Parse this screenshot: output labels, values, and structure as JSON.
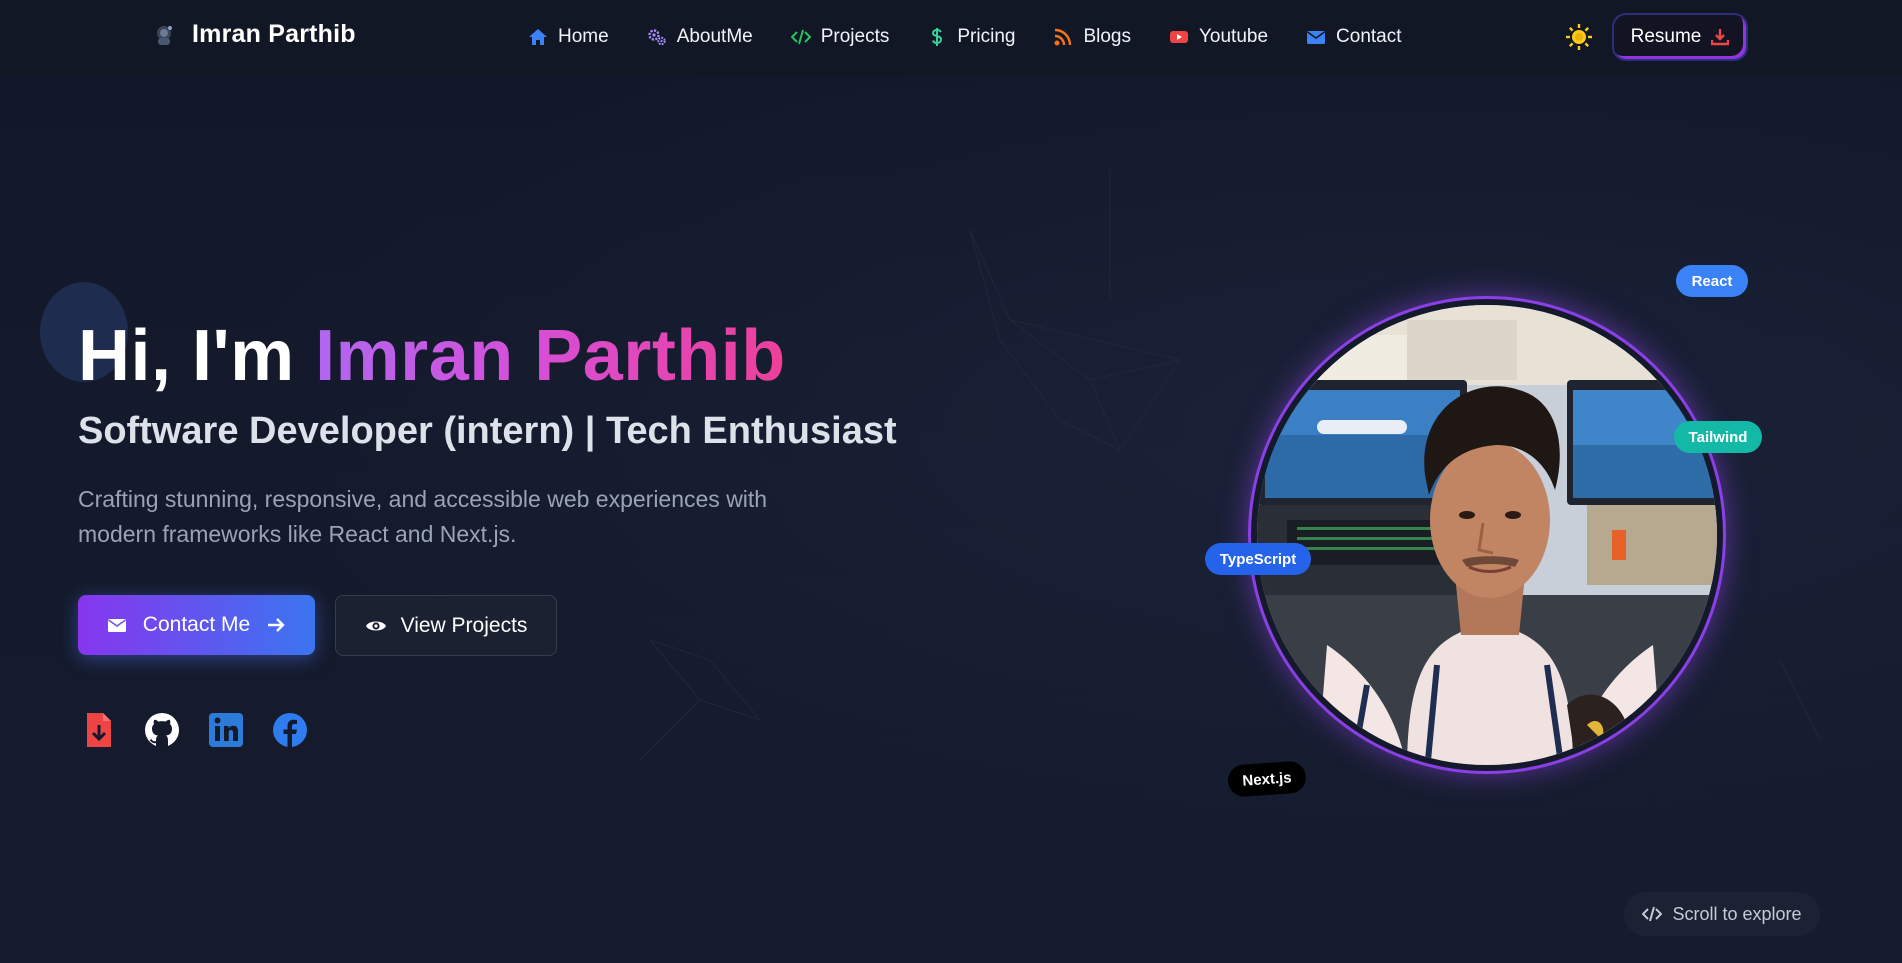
{
  "brand": {
    "name": "Imran Parthib",
    "logo_icon": "astronaut-logo-icon"
  },
  "nav": {
    "items": [
      {
        "label": "Home",
        "icon": "home-icon",
        "color": "#3b82f6"
      },
      {
        "label": "AboutMe",
        "icon": "gears-icon",
        "color": "#a78bfa"
      },
      {
        "label": "Projects",
        "icon": "code-icon",
        "color": "#22c55e"
      },
      {
        "label": "Pricing",
        "icon": "dollar-icon",
        "color": "#34d399"
      },
      {
        "label": "Blogs",
        "icon": "rss-icon",
        "color": "#f97316"
      },
      {
        "label": "Youtube",
        "icon": "youtube-icon",
        "color": "#ef4444"
      },
      {
        "label": "Contact",
        "icon": "envelope-icon",
        "color": "#3b82f6"
      }
    ],
    "theme_toggle_icon": "sun-icon",
    "resume_label": "Resume"
  },
  "hero": {
    "greeting": "Hi, I'm ",
    "name": "Imran Parthib",
    "subtitle": "Software Developer (intern) | Tech Enthusiast",
    "description_line1": "Crafting stunning, responsive, and accessible web experiences with",
    "description_line2": "modern frameworks like React and Next.js.",
    "contact_button": "Contact Me",
    "projects_button": "View Projects"
  },
  "socials": [
    {
      "name": "resume-download",
      "icon": "file-download-icon",
      "color": "#ef4444"
    },
    {
      "name": "github",
      "icon": "github-icon",
      "color": "#ffffff"
    },
    {
      "name": "linkedin",
      "icon": "linkedin-icon",
      "color": "#2563eb"
    },
    {
      "name": "facebook",
      "icon": "facebook-icon",
      "color": "#3b82f6"
    }
  ],
  "tech_tags": {
    "react": "React",
    "tailwind": "Tailwind",
    "typescript": "TypeScript",
    "nextjs": "Next.js"
  },
  "scroll_hint": "Scroll to explore",
  "colors": {
    "background": "#141a2b",
    "accent_purple": "#8736ee",
    "accent_blue": "#3b75f0",
    "name_gradient_start": "#b167f0",
    "name_gradient_end": "#ee3f98"
  }
}
